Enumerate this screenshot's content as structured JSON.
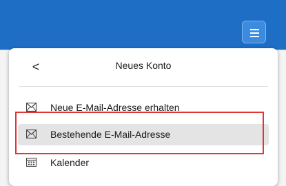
{
  "header": {
    "menu_icon": "hamburger-menu-icon"
  },
  "panel": {
    "back_icon": "chevron-left-icon",
    "back_glyph": "<",
    "title": "Neues Konto",
    "items": [
      {
        "label": "Neue E-Mail-Adresse erhalten",
        "icon": "envelope-icon"
      },
      {
        "label": "Bestehende E-Mail-Adresse",
        "icon": "envelope-icon",
        "state": "hover"
      },
      {
        "label": "Kalender",
        "icon": "calendar-icon"
      }
    ]
  },
  "colors": {
    "titlebar": "#1f6ec6",
    "menu_button": "#3b8ce0",
    "panel_background": "#ffffff",
    "hover_background": "#e4e4e4",
    "annotation_outline": "#e03636"
  }
}
